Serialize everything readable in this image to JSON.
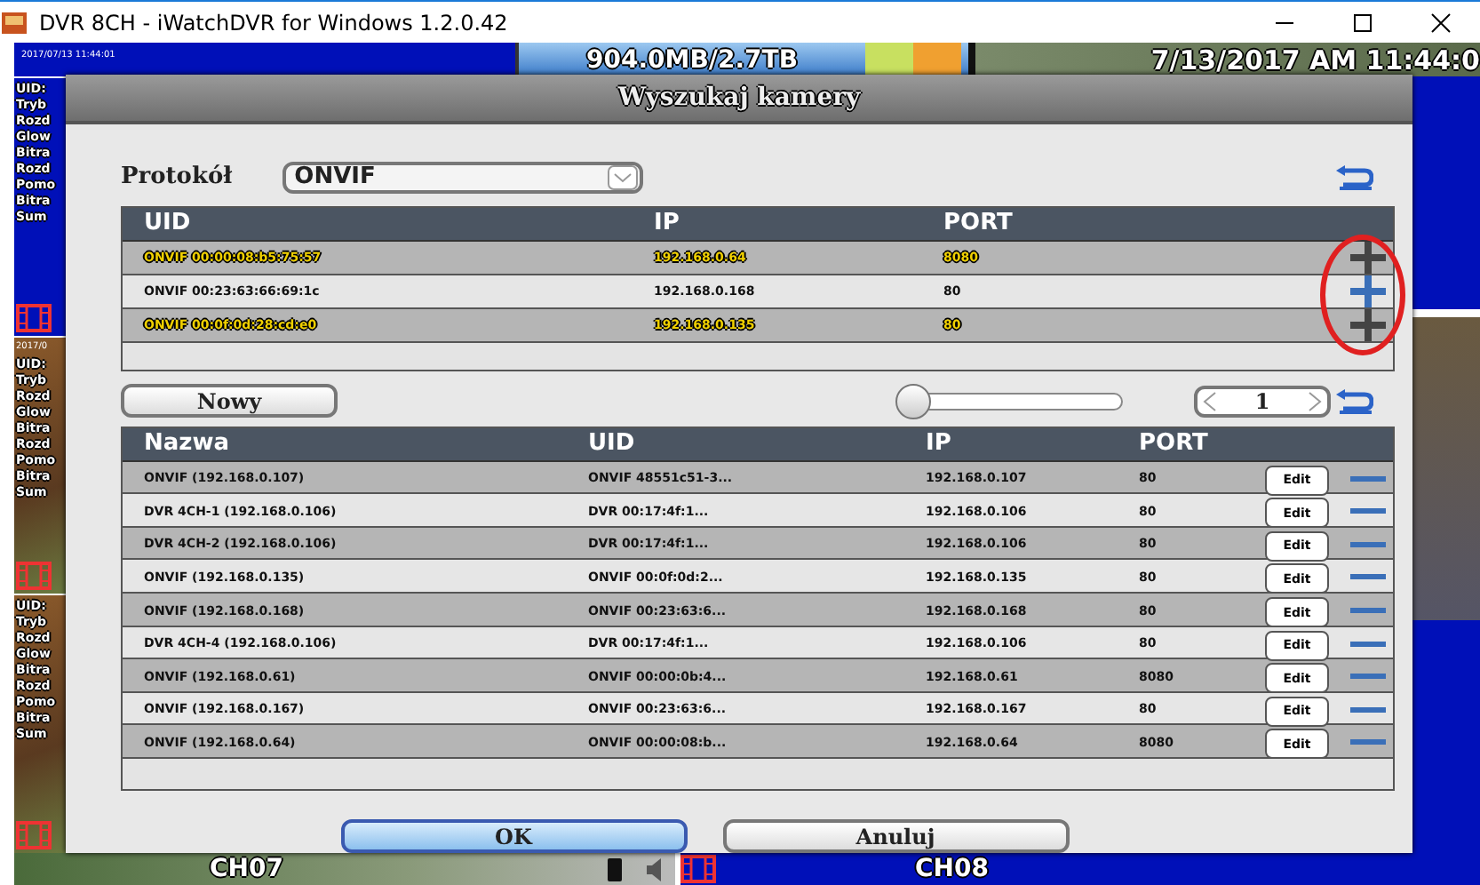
{
  "window": {
    "title": "DVR 8CH - iWatchDVR for Windows 1.2.0.42"
  },
  "dvr": {
    "timestamp": "2017/07/13 11:44:01",
    "storage": "904.0MB/2.7TB",
    "clock": "7/13/2017 AM 11:44:0",
    "tiles": [
      {
        "kind": "live",
        "lines": [
          "UID:",
          "Tryb",
          "Rozd",
          "Glow",
          "Bitra",
          "Rozd",
          "Pomo",
          "Bitra",
          "Sum"
        ]
      },
      {
        "kind": "photo",
        "date": "2017/0",
        "lines": [
          "UID:",
          "Tryb",
          "Rozd",
          "Glow",
          "Bitra",
          "Rozd",
          "Pomo",
          "Bitra",
          "Sum"
        ]
      },
      {
        "kind": "photo",
        "lines": [
          "UID:",
          "Tryb",
          "Rozd",
          "Glow",
          "Bitra",
          "Rozd",
          "Pomo",
          "Bitra",
          "Sum"
        ]
      }
    ],
    "channels": [
      {
        "label": "CH07",
        "kind": "photo"
      },
      {
        "label": "CH08",
        "kind": "live"
      }
    ]
  },
  "dialog": {
    "title": "Wyszukaj kamery",
    "protocol_label": "Protokół",
    "protocol": "ONVIF",
    "found": {
      "columns": [
        "UID",
        "IP",
        "PORT"
      ],
      "rows": [
        {
          "uid": "ONVIF 00:00:08:b5:75:57",
          "ip": "192.168.0.64",
          "port": "8080",
          "added": true
        },
        {
          "uid": "ONVIF 00:23:63:66:69:1c",
          "ip": "192.168.0.168",
          "port": "80",
          "added": false
        },
        {
          "uid": "ONVIF 00:0f:0d:28:cd:e0",
          "ip": "192.168.0.135",
          "port": "80",
          "added": true
        }
      ]
    },
    "new_button": "Nowy",
    "zoom": {
      "level": 0
    },
    "page": "1",
    "cameras": {
      "columns": [
        "Nazwa",
        "UID",
        "IP",
        "PORT"
      ],
      "rows": [
        {
          "name": "ONVIF (192.168.0.107)",
          "uid": "ONVIF 48551c51-3...",
          "ip": "192.168.0.107",
          "port": "80",
          "edit": "Edit"
        },
        {
          "name": "DVR 4CH-1 (192.168.0.106)",
          "uid": "DVR 00:17:4f:1...",
          "ip": "192.168.0.106",
          "port": "80",
          "edit": "Edit"
        },
        {
          "name": "DVR 4CH-2 (192.168.0.106)",
          "uid": "DVR 00:17:4f:1...",
          "ip": "192.168.0.106",
          "port": "80",
          "edit": "Edit"
        },
        {
          "name": "ONVIF (192.168.0.135)",
          "uid": "ONVIF 00:0f:0d:2...",
          "ip": "192.168.0.135",
          "port": "80",
          "edit": "Edit"
        },
        {
          "name": "ONVIF (192.168.0.168)",
          "uid": "ONVIF 00:23:63:6...",
          "ip": "192.168.0.168",
          "port": "80",
          "edit": "Edit"
        },
        {
          "name": "DVR 4CH-4 (192.168.0.106)",
          "uid": "DVR 00:17:4f:1...",
          "ip": "192.168.0.106",
          "port": "80",
          "edit": "Edit"
        },
        {
          "name": "ONVIF (192.168.0.61)",
          "uid": "ONVIF 00:00:0b:4...",
          "ip": "192.168.0.61",
          "port": "8080",
          "edit": "Edit"
        },
        {
          "name": "ONVIF (192.168.0.167)",
          "uid": "ONVIF 00:23:63:6...",
          "ip": "192.168.0.167",
          "port": "80",
          "edit": "Edit"
        },
        {
          "name": "ONVIF (192.168.0.64)",
          "uid": "ONVIF 00:00:08:b...",
          "ip": "192.168.0.64",
          "port": "8080",
          "edit": "Edit"
        }
      ]
    },
    "buttons": [
      {
        "label": "OK",
        "kind": "primary"
      },
      {
        "label": "Anuluj",
        "kind": "secondary"
      }
    ]
  }
}
